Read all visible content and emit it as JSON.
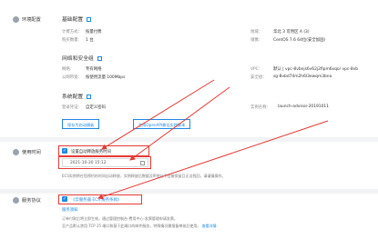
{
  "sections": {
    "env": "环境配置",
    "recycle": "使用时间",
    "agreement": "服务协议"
  },
  "basic": {
    "heading": "基础配置",
    "billing_label": "计费方式：",
    "billing_value": "按量付费",
    "instance_count_label": "购买数量：",
    "instance_count_value": "1 台",
    "region_label": "地域：",
    "region_value": "华北 3 可用区 A (3)",
    "image_label": "镜像：",
    "image_value": "CentOS 7.6 64位(安全加固)"
  },
  "network": {
    "heading": "网络和安全组",
    "type_label": "网络：",
    "type_value": "专有网络",
    "bandwidth_label": "公网带宽：",
    "bandwidth_value": "按使用流量 100Mbps",
    "vpc_label": "VPC：",
    "vpc_value": "默认 | vpc-8vbnjs6v62j2fipm6xqo/ vpc-8vb",
    "sg_label": "安全组：",
    "sg_value": "sg-8vbd74m2h6l3ewqm3bno"
  },
  "system": {
    "heading": "系统配置",
    "login_label": "登录凭证：",
    "login_value": "自定义密码",
    "name_label": "实例名称：",
    "name_value": "launch-advisor-20191011",
    "btn_template": "保存为启动模板",
    "btn_openapi": "生成OpenAPI最佳实践脚本"
  },
  "release": {
    "checkbox_label": "设置自动释放服务时间",
    "datetime": "2021-10-30 15:12",
    "note": "ECS实例将在您预约的时间自动释放，实例释放后数据及IP地址不会被保留且无法找回，请谨慎操作。"
  },
  "agreement": {
    "checkbox_label": "《云服务器 ECS 服务条款》",
    "link": "服务须知",
    "line1": "订单付款后将立即生效，通过管理控制台-费用中心-发票管理申请发票。",
    "line2": "至产品默认禁用 TCP 25 端口和基于此端口的邮件服务，特殊情况需报备审核后使用。",
    "more_link": "查看详情"
  }
}
